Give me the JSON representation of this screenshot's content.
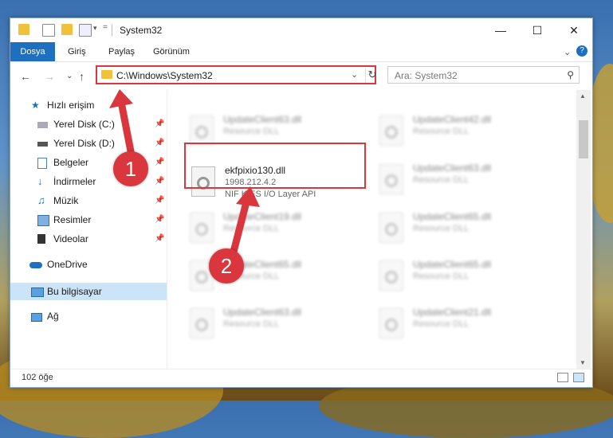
{
  "window": {
    "title": "System32",
    "ribbon_tabs": [
      "Dosya",
      "Giriş",
      "Paylaş",
      "Görünüm"
    ]
  },
  "address": {
    "path": "C:\\Windows\\System32",
    "search_placeholder": "Ara: System32"
  },
  "sidebar": {
    "quick_access": "Hızlı erişim",
    "items": [
      {
        "label": "Yerel Disk (C:)",
        "icon": "drive-icon"
      },
      {
        "label": "Yerel Disk (D:)",
        "icon": "drive-icon"
      },
      {
        "label": "Belgeler",
        "icon": "documents-icon"
      },
      {
        "label": "İndirmeler",
        "icon": "download-icon"
      },
      {
        "label": "Müzik",
        "icon": "music-icon"
      },
      {
        "label": "Resimler",
        "icon": "pictures-icon"
      },
      {
        "label": "Videolar",
        "icon": "video-icon"
      }
    ],
    "onedrive": "OneDrive",
    "this_pc": "Bu bilgisayar",
    "network": "Ağ"
  },
  "files": {
    "highlighted": {
      "name": "ekfpixio130.dll",
      "version": "1998.212.4.2",
      "description": "NIF KIES I/O Layer API"
    },
    "left_column": [
      {
        "name": "UpdateClient63.dll",
        "description": "Resource DLL"
      },
      {
        "name": "UpdateClient19.dll",
        "description": "Resource DLL"
      },
      {
        "name": "UpdateClient65.dll",
        "description": "Resource DLL"
      },
      {
        "name": "UpdateClient63.dll",
        "description": "Resource DLL"
      }
    ],
    "right_column": [
      {
        "name": "UpdateClient42.dll",
        "description": "Resource DLL"
      },
      {
        "name": "UpdateClient63.dll",
        "description": "Resource DLL"
      },
      {
        "name": "UpdateClient65.dll",
        "description": "Resource DLL"
      },
      {
        "name": "UpdateClient65.dll",
        "description": "Resource DLL"
      },
      {
        "name": "UpdateClient21.dll",
        "description": "Resource DLL"
      }
    ]
  },
  "status": {
    "item_count": "102 öğe"
  },
  "annotations": {
    "step1": "1",
    "step2": "2"
  },
  "colors": {
    "highlight": "#d9363e",
    "accent": "#1e6fbf",
    "selected": "#cce4f7"
  }
}
